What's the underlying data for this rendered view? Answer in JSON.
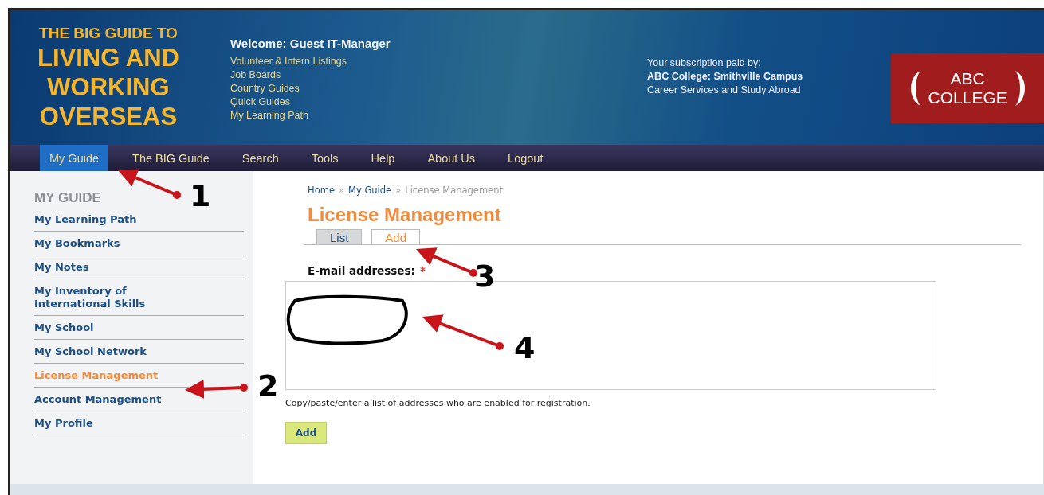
{
  "logo": {
    "lines": [
      "THE BIG GUIDE TO",
      "LIVING AND",
      "WORKING",
      "OVERSEAS"
    ]
  },
  "welcome": {
    "title": "Welcome: Guest IT-Manager",
    "links": [
      "Volunteer & Intern Listings",
      "Job Boards",
      "Country Guides",
      "Quick Guides",
      "My Learning Path"
    ]
  },
  "subscription": {
    "intro": "Your subscription paid by:",
    "school": "ABC College: Smithville Campus",
    "department": "Career Services and Study Abroad"
  },
  "college_logo": {
    "lines": [
      "ABC",
      "COLLEGE"
    ]
  },
  "nav": [
    {
      "label": "My Guide",
      "selected": true
    },
    {
      "label": "The BIG Guide",
      "selected": false
    },
    {
      "label": "Search",
      "selected": false
    },
    {
      "label": "Tools",
      "selected": false
    },
    {
      "label": "Help",
      "selected": false
    },
    {
      "label": "About Us",
      "selected": false
    },
    {
      "label": "Logout",
      "selected": false
    }
  ],
  "sidebar": {
    "title": "MY GUIDE",
    "items": [
      {
        "label": "My Learning Path",
        "selected": false
      },
      {
        "label": "My Bookmarks",
        "selected": false
      },
      {
        "label": "My Notes",
        "selected": false
      },
      {
        "label": "My Inventory of International Skills",
        "selected": false
      },
      {
        "label": "My School",
        "selected": false
      },
      {
        "label": "My School Network",
        "selected": false
      },
      {
        "label": "License Management",
        "selected": true
      },
      {
        "label": "Account Management",
        "selected": false
      },
      {
        "label": "My Profile",
        "selected": false
      }
    ]
  },
  "breadcrumb": {
    "links": [
      "Home",
      "My Guide"
    ],
    "separator": "»",
    "current": "License Management"
  },
  "page_title": "License Management",
  "tabs": [
    {
      "label": "List",
      "selected": false
    },
    {
      "label": "Add",
      "selected": true
    }
  ],
  "form": {
    "label": "E-mail addresses:",
    "required_mark": "*",
    "help": "Copy/paste/enter a list of addresses who are enabled for registration.",
    "button": "Add"
  },
  "annotations": [
    {
      "label": "1"
    },
    {
      "label": "2"
    },
    {
      "label": "3"
    },
    {
      "label": "4"
    }
  ]
}
